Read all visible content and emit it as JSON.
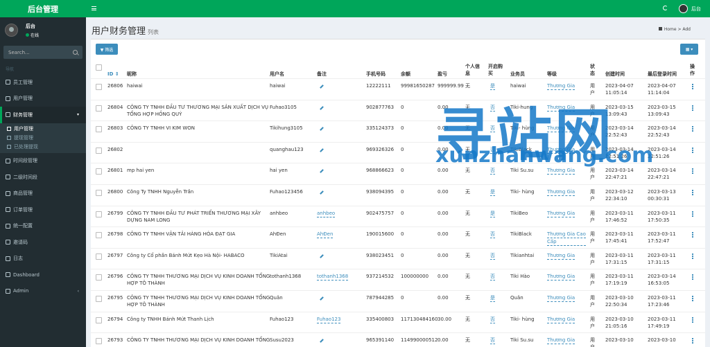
{
  "app": {
    "logo_text": "后台管理"
  },
  "user_panel": {
    "name": "后台",
    "status": "在线"
  },
  "search": {
    "placeholder": "Search..."
  },
  "nav": {
    "header": "导航",
    "items": [
      {
        "label": "员工管理",
        "icon": "user-icon"
      },
      {
        "label": "用户管理",
        "icon": "user-icon"
      },
      {
        "label": "财务管理",
        "icon": "wallet-icon",
        "active": true
      },
      {
        "label": "时间段管理",
        "icon": "calendar-icon"
      },
      {
        "label": "二级时间段",
        "icon": "calendar-icon"
      },
      {
        "label": "商品管理",
        "icon": "list-icon"
      },
      {
        "label": "订单管理",
        "icon": "cart-icon"
      },
      {
        "label": "统一配置",
        "icon": "desktop-icon"
      },
      {
        "label": "邀请码",
        "icon": "folder-icon"
      },
      {
        "label": "日志",
        "icon": "log-icon"
      },
      {
        "label": "Dashboard",
        "icon": "dashboard-icon"
      },
      {
        "label": "Admin",
        "icon": "settings-icon"
      }
    ],
    "sub_items": [
      {
        "label": "用户管理",
        "icon": "download-icon",
        "active": true
      },
      {
        "label": "提现管理",
        "icon": "doc-icon"
      },
      {
        "label": "已处理提现",
        "icon": "doc-icon"
      }
    ]
  },
  "topbar": {
    "user": "后台"
  },
  "page": {
    "title": "用户财务管理",
    "subtitle": "列表"
  },
  "breadcrumb": {
    "home": "Home",
    "current": "Add"
  },
  "toolbar": {
    "filter_label": "▼ 筛选",
    "columns_label": "▦ ▾"
  },
  "table": {
    "headers": {
      "id": "ID ⇕",
      "nickname": "昵称",
      "username": "用户名",
      "remark": "备注",
      "phone": "手机号码",
      "balance": "余额",
      "profit": "盈亏",
      "personal": [
        "个人信",
        "息"
      ],
      "open": [
        "开启购",
        "买"
      ],
      "agent": "业务员",
      "level": "等级",
      "status": [
        "状",
        "态"
      ],
      "created": "创建时间",
      "last_login": "最后登录时间",
      "action": [
        "操",
        "作"
      ]
    },
    "rows": [
      {
        "id": "26806",
        "nickname": [
          "haiwai",
          ""
        ],
        "username": "haiwai",
        "remark": "",
        "phone": "12222111",
        "balance": "99981650287",
        "profit": "999999.99",
        "personal": "无",
        "open": "是",
        "agent": "haiwai",
        "level": [
          "Thương Gia",
          ""
        ],
        "status": [
          "用",
          "户"
        ],
        "created": [
          "2023-04-07",
          "11:05:14"
        ],
        "last": [
          "2023-04-07",
          "11:14:04"
        ]
      },
      {
        "id": "26804",
        "nickname": [
          "CÔNG TY TNHH ĐẦU TƯ THƯƠNG MẠI SẢN XUẤT DỊCH VỤ",
          "TỔNG HỢP HỒNG QUÝ"
        ],
        "username": "Fuhao3105",
        "remark": "",
        "phone": "902877763",
        "balance": "0",
        "profit": "0.00",
        "personal": "无",
        "open": "否",
        "agent": "Tiki-hung",
        "level": [
          "Thương Gia",
          ""
        ],
        "status": [
          "用",
          "户"
        ],
        "created": [
          "2023-03-15",
          "13:09:43"
        ],
        "last": [
          "2023-03-15",
          "13:09:43"
        ]
      },
      {
        "id": "26803",
        "nickname": [
          "CÔNG TY TNHH VI KIM WON",
          ""
        ],
        "username": "Tikihung3105",
        "remark": "",
        "phone": "335124373",
        "balance": "0",
        "profit": "0.00",
        "personal": "无",
        "open": "否",
        "agent": "Tiki- hùng",
        "level": [
          "Thương Gia",
          ""
        ],
        "status": [
          "用",
          "户"
        ],
        "created": [
          "2023-03-14",
          "22:52:43"
        ],
        "last": [
          "2023-03-14",
          "22:52:43"
        ]
      },
      {
        "id": "26802",
        "nickname": [
          "",
          ""
        ],
        "username": "quanghau123",
        "remark": "",
        "phone": "969326326",
        "balance": "0",
        "profit": "0.00",
        "personal": "无",
        "open": "否",
        "agent": "TikiBlack",
        "level": [
          "Thương Gia",
          ""
        ],
        "status": [
          "用",
          "户"
        ],
        "created": [
          "2023-03-14",
          "22:51:26"
        ],
        "last": [
          "2023-03-14",
          "22:51:26"
        ]
      },
      {
        "id": "26801",
        "nickname": [
          "mp hai yen",
          ""
        ],
        "username": "hai yen",
        "remark": "",
        "phone": "968866623",
        "balance": "0",
        "profit": "0.00",
        "personal": "无",
        "open": "否",
        "agent": "Tiki Su.su",
        "level": [
          "Thương Gia",
          ""
        ],
        "status": [
          "用",
          "户"
        ],
        "created": [
          "2023-03-14",
          "22:47:21"
        ],
        "last": [
          "2023-03-14",
          "22:47:21"
        ]
      },
      {
        "id": "26800",
        "nickname": [
          "Công Ty TNHH Nguyễn Trần",
          ""
        ],
        "username": "Fuhao123456",
        "remark": "",
        "phone": "938094395",
        "balance": "0",
        "profit": "0.00",
        "personal": "无",
        "open": "是",
        "agent": "Tiki- hùng",
        "level": [
          "Thương Gia",
          ""
        ],
        "status": [
          "用",
          "户"
        ],
        "created": [
          "2023-03-12",
          "22:34:10"
        ],
        "last": [
          "2023-03-13",
          "00:30:31"
        ]
      },
      {
        "id": "26799",
        "nickname": [
          "CÔNG TY TNHH ĐẦU TƯ PHÁT TRIỂN THƯƠNG MẠI XÂY",
          "DỰNG NAM LONG"
        ],
        "username": "anhbeo",
        "remark": "anhbeo",
        "phone": "902475757",
        "balance": "0",
        "profit": "0.00",
        "personal": "无",
        "open": "是",
        "agent": "TikiBeo",
        "level": [
          "Thương Gia",
          ""
        ],
        "status": [
          "用",
          "户"
        ],
        "created": [
          "2023-03-11",
          "17:46:52"
        ],
        "last": [
          "2023-03-11",
          "17:50:35"
        ]
      },
      {
        "id": "26798",
        "nickname": [
          "CÔNG TY TNHH VẬN TẢI HÀNG HÓA ĐẠT GIA",
          ""
        ],
        "username": "AhĐen",
        "remark": "AhĐen",
        "phone": "190015600",
        "balance": "0",
        "profit": "0.00",
        "personal": "无",
        "open": "否",
        "agent": "TikiBlack",
        "level": [
          "Thương Gia Cao",
          "Cấp"
        ],
        "status": [
          "用",
          "户"
        ],
        "created": [
          "2023-03-11",
          "17:45:41"
        ],
        "last": [
          "2023-03-11",
          "17:52:47"
        ]
      },
      {
        "id": "26797",
        "nickname": [
          "Công ty Cổ phần Bánh Mứt Kẹo Hà Nội- HABACO",
          ""
        ],
        "username": "TikiAtai",
        "remark": "",
        "phone": "938023451",
        "balance": "0",
        "profit": "0.00",
        "personal": "无",
        "open": "否",
        "agent": "Tikianhtai",
        "level": [
          "Thương Gia",
          ""
        ],
        "status": [
          "用",
          "户"
        ],
        "created": [
          "2023-03-11",
          "17:31:15"
        ],
        "last": [
          "2023-03-11",
          "17:31:15"
        ]
      },
      {
        "id": "26796",
        "nickname": [
          "CÔNG TY TNHH THƯƠNG MẠI DỊCH VỤ KINH DOANH TỔNG",
          "HỢP TÔ THÀNH"
        ],
        "username": "tothanh1368",
        "remark": "tothanh1368",
        "phone": "937214532",
        "balance": "100000000",
        "profit": "0.00",
        "personal": "无",
        "open": "否",
        "agent": "Tiki Hào",
        "level": [
          "Thương Gia",
          ""
        ],
        "status": [
          "用",
          "户"
        ],
        "created": [
          "2023-03-11",
          "17:19:19"
        ],
        "last": [
          "2023-03-14",
          "16:53:05"
        ]
      },
      {
        "id": "26795",
        "nickname": [
          "CÔNG TY TNHH THƯƠNG MẠI DỊCH VỤ KINH DOANH TỔNG",
          "HỢP TÔ THÀNH"
        ],
        "username": "Quân",
        "remark": "",
        "phone": "787944285",
        "balance": "0",
        "profit": "0.00",
        "personal": "无",
        "open": "是",
        "agent": "Quân",
        "level": [
          "Thương Gia",
          ""
        ],
        "status": [
          "用",
          "户"
        ],
        "created": [
          "2023-03-10",
          "22:50:34"
        ],
        "last": [
          "2023-03-11",
          "17:23:46"
        ]
      },
      {
        "id": "26794",
        "nickname": [
          "Công ty TNHH Bánh Mứt Thanh Lịch",
          ""
        ],
        "username": "Fuhao123",
        "remark": "Fuhao123",
        "phone": "335400803",
        "balance": "117130484160",
        "profit": "30.00",
        "personal": "无",
        "open": "否",
        "agent": "Tiki- hùng",
        "level": [
          "Thương Gia",
          ""
        ],
        "status": [
          "用",
          "户"
        ],
        "created": [
          "2023-03-10",
          "21:05:16"
        ],
        "last": [
          "2023-03-11",
          "17:49:19"
        ]
      },
      {
        "id": "26793",
        "nickname": [
          "CÔNG TY TNHH THƯƠNG MẠI DỊCH VỤ KINH DOANH TỔNG",
          ""
        ],
        "username": "Susu2023",
        "remark": "",
        "phone": "965391140",
        "balance": "114990000512",
        "profit": "0.00",
        "personal": "无",
        "open": "否",
        "agent": "Tiki Su.su",
        "level": [
          "Thương Gia",
          ""
        ],
        "status": [
          "用",
          "户"
        ],
        "created": [
          "2023-03-10",
          ""
        ],
        "last": [
          "2023-03-10",
          ""
        ]
      }
    ]
  },
  "watermark": {
    "cn": "寻站网",
    "en": "xunzhanwang.com"
  }
}
